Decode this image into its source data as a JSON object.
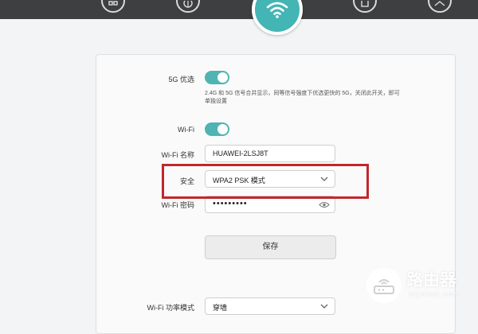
{
  "nav": {
    "icons": [
      "apps-icon",
      "globe-icon",
      "wifi-icon",
      "device-icon",
      "settings-icon"
    ]
  },
  "settings": {
    "band_steering": {
      "label": "5G 优选",
      "enabled": true
    },
    "band_steering_hint": "2.4G 和 5G 信号合并显示，同等信号强度下优选更快的 5G，关闭此开关，即可单独设置",
    "wifi": {
      "label": "Wi-Fi",
      "enabled": true
    },
    "wifi_name": {
      "label": "Wi-Fi 名称",
      "value": "HUAWEI-2LSJ8T"
    },
    "security": {
      "label": "安全",
      "value": "WPA2 PSK 模式"
    },
    "wifi_password": {
      "label": "Wi-Fi 密码",
      "masked": "•••••••••"
    },
    "save_label": "保存",
    "power_mode": {
      "label": "Wi-Fi 功率模式",
      "value": "穿墙"
    }
  },
  "watermark": {
    "brand": "路由器",
    "url": "luyouqi.com"
  },
  "colors": {
    "accent": "#4fb4b3",
    "highlight": "#c1272d",
    "topbar": "#3d3f40"
  }
}
